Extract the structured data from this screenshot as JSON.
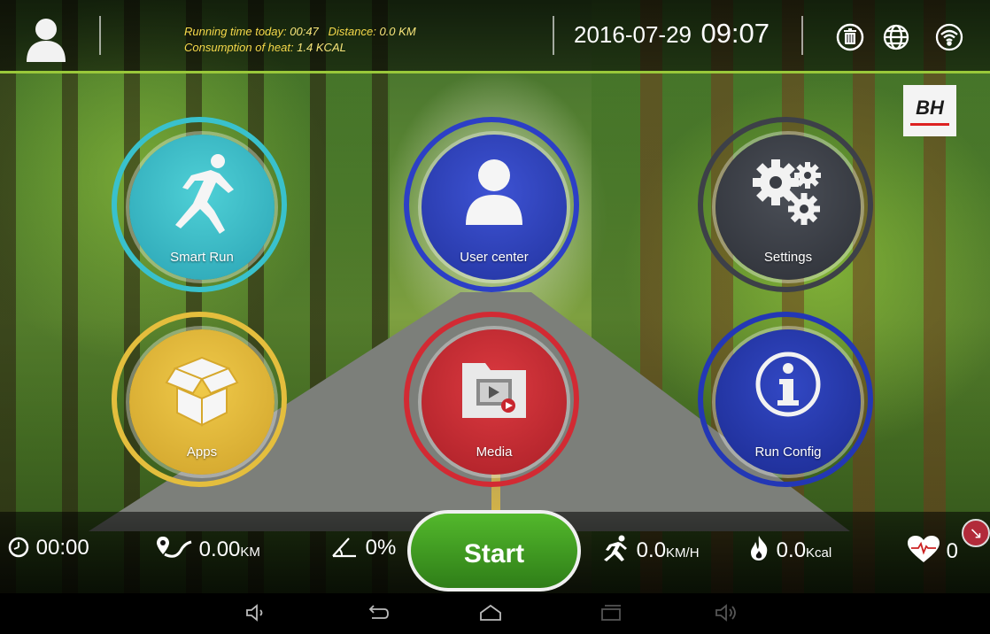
{
  "header": {
    "running_time_label": "Running time today:",
    "running_time_value": "00:47",
    "distance_label": "Distance:",
    "distance_value": "0.0 KM",
    "heat_label": "Consumption of heat:",
    "heat_value": "1.4 KCAL",
    "date": "2016-07-29",
    "time": "09:07",
    "status_icons": [
      "trash-icon",
      "globe-icon",
      "wifi-icon"
    ]
  },
  "brand": {
    "logo_text": "BH"
  },
  "tiles": [
    {
      "label": "Smart Run",
      "icon": "runner-icon",
      "color": "#2fb3bf",
      "ring": "#39c1cc"
    },
    {
      "label": "User center",
      "icon": "user-icon",
      "color": "#2a3fb8",
      "ring": "#2c3fc6"
    },
    {
      "label": "Settings",
      "icon": "gears-icon",
      "color": "#3a3d44",
      "ring": "#3d4048"
    },
    {
      "label": "Apps",
      "icon": "box-icon",
      "color": "#e0b534",
      "ring": "#e4be3d"
    },
    {
      "label": "Media",
      "icon": "media-folder-icon",
      "color": "#c8262e",
      "ring": "#d22a33"
    },
    {
      "label": "Run Config",
      "icon": "info-icon",
      "color": "#23349f",
      "ring": "#2337b5"
    }
  ],
  "metrics": {
    "time": "00:00",
    "distance_value": "0.00",
    "distance_unit": "KM",
    "incline": "0%",
    "speed_value": "0.0",
    "speed_unit": "KM/H",
    "calories_value": "0.0",
    "calories_unit": "Kcal",
    "heart_rate": "0"
  },
  "start_button": {
    "label": "Start"
  },
  "navbar": [
    "volume-down-icon",
    "back-icon",
    "home-icon",
    "recent-apps-icon",
    "volume-up-icon"
  ]
}
